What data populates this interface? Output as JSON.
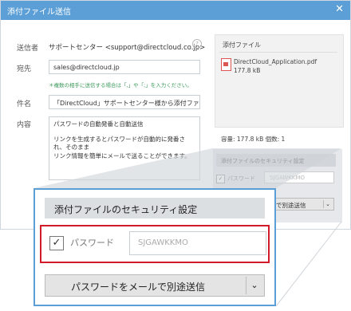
{
  "dialog": {
    "title": "添付ファイル送信",
    "close": "✕"
  },
  "form": {
    "sender_label": "送信者",
    "sender_value": "サポートセンター <support@directcloud.co.jp>",
    "help": "?",
    "to_label": "宛先",
    "to_value": "sales@directcloud.jp",
    "hint": "＊複数の相手に送信する場合は「,」や「;」を入力ください。",
    "subject_label": "件名",
    "subject_value": "「DirectCloud」サポートセンター様から添付ファイル",
    "body_label": "内容",
    "body_lines": [
      "パスワードの自動発番と自動送信",
      "",
      "リンクを生成するとパスワードが自動的に発番され、そのまま",
      "リンク情報を簡単にメールで送ることができます。"
    ]
  },
  "attachments": {
    "header": "添付ファイル",
    "file_name": "DirectCloud_Application.pdf",
    "file_size": "177.8 kB",
    "stats": "容量: 177.8 kB  個数: 1"
  },
  "security": {
    "title": "添付ファイルのセキュリティ設定",
    "checkbox": "✓",
    "password_label": "パスワード",
    "password_value": "SJGAWKKMO",
    "send_button": "パスワードをメールで別途送信",
    "send_button_short": "で別途送信",
    "dropdown": "⌄"
  },
  "colors": {
    "accent": "#5b9fd6",
    "highlight": "#d11a2a"
  }
}
